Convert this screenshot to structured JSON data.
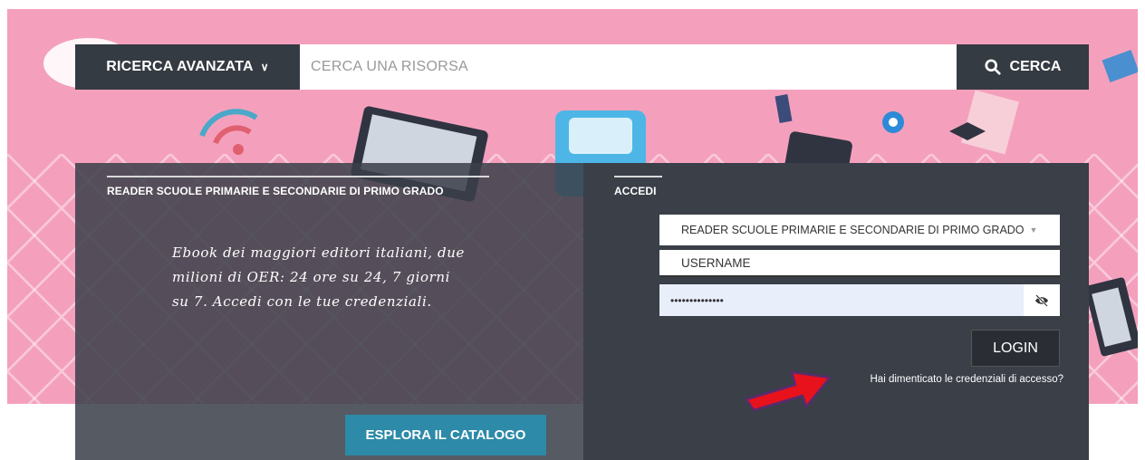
{
  "search": {
    "advanced_label": "RICERCA AVANZATA",
    "placeholder": "CERCA UNA RISORSA",
    "search_button_label": "CERCA",
    "search_icon": "search-icon"
  },
  "left_panel": {
    "title": "READER SCUOLE PRIMARIE E SECONDARIE DI PRIMO GRADO",
    "description": "Ebook dei maggiori editori italiani, due milioni di OER: 24 ore su 24, 7 giorni su 7. Accedi con le tue credenziali.",
    "explore_button_label": "ESPLORA IL CATALOGO"
  },
  "login_panel": {
    "title": "ACCEDI",
    "selected_reader": "READER SCUOLE PRIMARIE E SECONDARIE DI PRIMO GRADO",
    "username_value": "USERNAME",
    "password_value": "••••••••••••••",
    "login_button_label": "LOGIN",
    "forgot_link_label": "Hai dimenticato le credenziali di accesso?"
  },
  "colors": {
    "hero_pink": "#f4a0bd",
    "dark_panel": "#3a3f48",
    "accent_teal": "#2d8aa8",
    "arrow_red": "#e8121c"
  }
}
